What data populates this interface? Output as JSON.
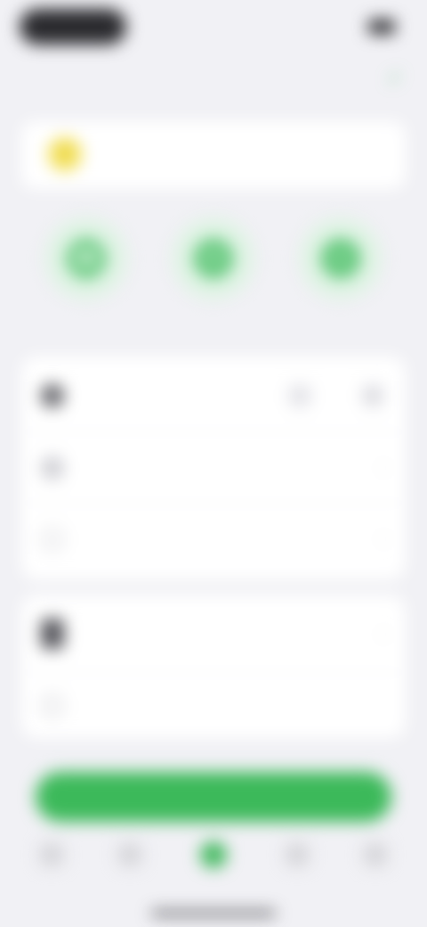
{
  "status_bar": {
    "time": "",
    "indicators": ""
  },
  "header": {
    "title": "",
    "check_icon": "check-icon"
  },
  "banner": {
    "icon": "bulb-icon",
    "title": "",
    "subtitle": ""
  },
  "quick_actions": [
    {
      "icon": "phone-icon",
      "label": ""
    },
    {
      "icon": "message-icon",
      "label": ""
    },
    {
      "icon": "location-icon",
      "label": ""
    }
  ],
  "card1": {
    "rows": [
      {
        "icon": "person-icon",
        "title": "",
        "stepper": {
          "minus": "−",
          "value": "",
          "plus": "+"
        }
      },
      {
        "icon": "clock-icon",
        "text": "",
        "chevron": "›"
      },
      {
        "icon": "info-icon",
        "text": "",
        "chevron": "›"
      }
    ]
  },
  "card2": {
    "rows": [
      {
        "icon": "document-icon",
        "title": "",
        "subtitle": "",
        "chevron": "›"
      },
      {
        "icon": "note-icon",
        "text": ""
      }
    ]
  },
  "primary_button": {
    "label": ""
  },
  "tabbar": {
    "tabs": [
      {
        "icon": "home-icon",
        "label": "",
        "active": false
      },
      {
        "icon": "list-icon",
        "label": "",
        "active": false
      },
      {
        "icon": "plus-icon",
        "label": "",
        "active": true
      },
      {
        "icon": "chat-icon",
        "label": "",
        "active": false
      },
      {
        "icon": "profile-icon",
        "label": "",
        "active": false
      }
    ]
  },
  "colors": {
    "accent": "#3cb95a",
    "banner_title": "#4cbf64",
    "quick_action_bg": "#dff3e4",
    "banner_icon": "#f4e15a",
    "background": "#f1f1f5"
  }
}
